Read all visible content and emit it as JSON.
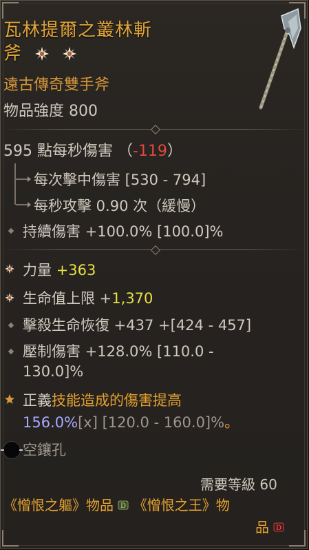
{
  "item": {
    "name_line1": "瓦林提爾之叢林斬",
    "name_line2": "斧",
    "rarity": "遠古傳奇雙手斧",
    "item_power": "物品強度 800"
  },
  "dps": {
    "value": "595",
    "label": " 點每秒傷害 （",
    "delta": "-119",
    "close": "）"
  },
  "weapon_stats": [
    {
      "label": "每次擊中傷害 [530 - 794]"
    },
    {
      "label": "每秒攻擊 0.90 次（緩慢）"
    }
  ],
  "implicit": "持續傷害 +100.0% [100.0]%",
  "affixes": {
    "strength": {
      "label": "力量 ",
      "value": "+363"
    },
    "life": {
      "label": "生命值上限 +",
      "value": "1,370"
    },
    "life_on_kill": "擊殺生命恢復 +437 +[424 - 457]",
    "overpower_line1": "壓制傷害 +128.0% [110.0 -",
    "overpower_line2": "130.0]%"
  },
  "aspect": {
    "line1_a": "正義",
    "line1_b": "技能造成的傷害提高",
    "line2_a": "156.0%",
    "line2_b": "[x] [120.0 - 160.0]%",
    "line2_c": "。"
  },
  "socket": {
    "label": "空鑲孔"
  },
  "requirements": {
    "level": "需要等級 60",
    "source_a": "《憎恨之軀》物品",
    "source_b": "《憎恨之王》物",
    "source_c": "品"
  },
  "colors": {
    "title": "#e0a43a",
    "rarity": "#d4963a",
    "stat_text": "#d0c9be",
    "highlight": "#e8e045",
    "negative": "#e04a3a",
    "aspect_blue": "#a8a9ff",
    "border": "#5a5248"
  },
  "icons": [
    "weapon-axe-image",
    "greater-affix-icon",
    "affix-diamond-icon",
    "aspect-star-icon",
    "socket-icon",
    "expansion-badge-icon"
  ]
}
